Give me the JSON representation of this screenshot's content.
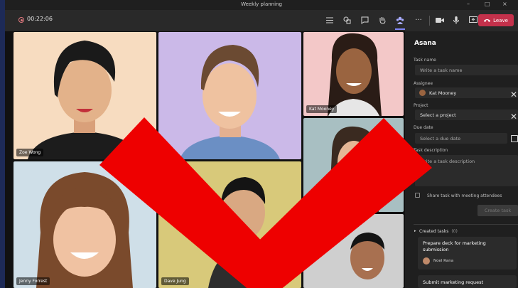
{
  "window": {
    "title": "Weekly planning",
    "minimize": "–",
    "maximize": "□",
    "close": "×"
  },
  "toolbar": {
    "timer": "00:22:06",
    "icons": [
      "list-icon",
      "reactions-icon",
      "chat-icon",
      "raise-hand-icon",
      "people-icon",
      "more-icon",
      "camera-icon",
      "mic-icon",
      "share-screen-icon",
      "hangup-icon"
    ],
    "leave_label": "Leave",
    "more_label": "···",
    "colors": {
      "leave": "#c4314b",
      "active": "#7f85f5"
    }
  },
  "participants": [
    {
      "name": "Zoe Wong",
      "bg": "#f7dcc0"
    },
    {
      "name": "",
      "bg": "#cbb9e8"
    },
    {
      "name": "Kat Mooney",
      "bg": "#f3c8c8"
    },
    {
      "name": "",
      "bg": "#a8bfc2"
    },
    {
      "name": "Jenny Forrest",
      "bg": "#cfdfe8"
    },
    {
      "name": "Dave Jung",
      "bg": "#d8c97a"
    },
    {
      "name": "",
      "bg": "#cfcfcf"
    }
  ],
  "panel": {
    "title": "Asana",
    "task_name": {
      "label": "Task name",
      "placeholder": "Write a task name"
    },
    "assignee": {
      "label": "Assignee",
      "value": "Kat Mooney"
    },
    "project": {
      "label": "Project",
      "placeholder": "Select a project"
    },
    "due_date": {
      "label": "Due date",
      "placeholder": "Select a due date"
    },
    "description": {
      "label": "Task description",
      "placeholder": "Write a task description"
    },
    "share_label": "Share task with meeting attendees",
    "create_label": "Create task",
    "created_header": "Created tasks",
    "created_count": "(0)",
    "cards": [
      {
        "title": "Prepare deck for marketing submission",
        "assignee": "Noel Rana"
      },
      {
        "title": "Submit marketing request",
        "assignee": ""
      }
    ]
  },
  "overlay": {
    "mark": "red-x",
    "color": "#ee0000"
  }
}
